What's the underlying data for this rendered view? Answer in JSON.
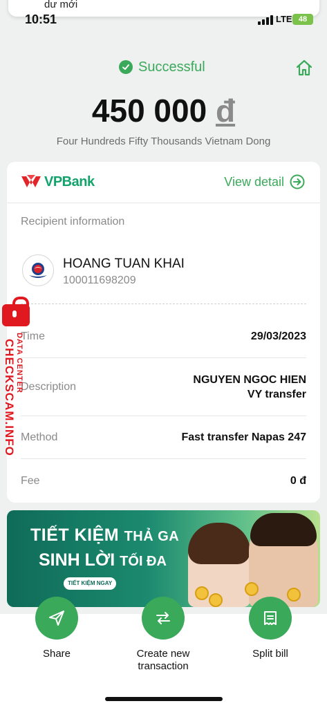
{
  "notification": {
    "text": "dư mới"
  },
  "status_bar": {
    "time": "10:51",
    "network": "LTE",
    "battery": "48"
  },
  "header": {
    "status": "Successful"
  },
  "amount": {
    "value": "450 000",
    "currency": "đ",
    "words": "Four Hundreds Fifty Thousands Vietnam Dong"
  },
  "card": {
    "bank": "VPBank",
    "view_detail": "View detail",
    "recipient_label": "Recipient information",
    "recipient_name": "HOANG TUAN KHAI",
    "recipient_account": "100011698209",
    "rows": [
      {
        "key": "Time",
        "value": "29/03/2023"
      },
      {
        "key": "Description",
        "value_line1": "NGUYEN NGOC HIEN",
        "value_line2": "VY transfer"
      },
      {
        "key": "Method",
        "value": "Fast transfer Napas 247"
      },
      {
        "key": "Fee",
        "value": "0 đ"
      }
    ]
  },
  "watermark": {
    "main": "CHECKSCAM.INFO",
    "sub": "DATA CENTER"
  },
  "banner": {
    "line1_big": "TIẾT KIỆM",
    "line1_small": "THẢ GA",
    "line2_big": "SINH LỜI",
    "line2_small": "TỐI ĐA",
    "cta": "TIẾT KIỆM NGAY"
  },
  "actions": {
    "share": "Share",
    "create_line1": "Create new",
    "create_line2": "transaction",
    "split": "Split bill"
  },
  "colors": {
    "accent": "#3aa95a",
    "watermark": "#e0181f",
    "brand": "#12a36b"
  }
}
